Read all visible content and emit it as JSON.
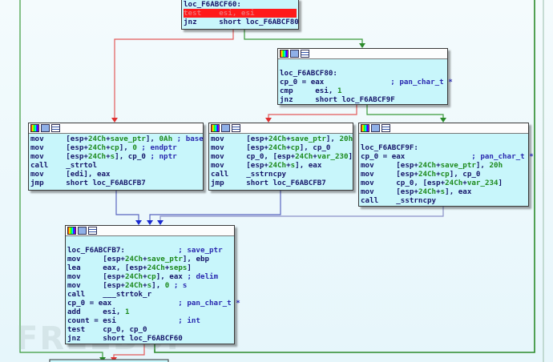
{
  "colors": {
    "true_edge": "#2a8a2a",
    "false_edge": "#e03030",
    "jump_edge": "#3040c0",
    "block_bg": "#c8f6fb",
    "highlight": "#ff1a1a"
  },
  "header_icons": [
    "graph-overview-icon",
    "edit-icon",
    "listing-icon"
  ],
  "blocks": [
    {
      "id": "loc_F6ABCF60",
      "header": false,
      "lines": [
        [
          [
            "loc_F6ABCF60:",
            "i"
          ]
        ],
        [
          [
            "test    ",
            "i"
          ],
          [
            "esi, esi",
            "i"
          ]
        ],
        [
          [
            "jnz     ",
            "i"
          ],
          [
            "short loc_F6ABCF80",
            "i"
          ]
        ]
      ],
      "highlight": 1
    },
    {
      "id": "loc_F6ABCF80",
      "header": true,
      "lines": [
        [
          [
            "",
            "i"
          ]
        ],
        [
          [
            "loc_F6ABCF80:",
            "i"
          ]
        ],
        [
          [
            "cp_0 = eax",
            "i"
          ],
          [
            "               ; pan_char_t *",
            "b"
          ]
        ],
        [
          [
            "cmp     ",
            "i"
          ],
          [
            "esi, ",
            "i"
          ],
          [
            "1",
            "g"
          ]
        ],
        [
          [
            "jnz     ",
            "i"
          ],
          [
            "short loc_F6ABCF9F",
            "i"
          ]
        ]
      ]
    },
    {
      "id": "block_strtol",
      "header": true,
      "lines": [
        [
          [
            "mov     ",
            "i"
          ],
          [
            "[esp+",
            "i"
          ],
          [
            "24Ch",
            "g"
          ],
          [
            "+",
            "i"
          ],
          [
            "save_ptr",
            "g"
          ],
          [
            "], ",
            "i"
          ],
          [
            "0Ah",
            "g"
          ],
          [
            " ; base",
            "b"
          ]
        ],
        [
          [
            "mov     ",
            "i"
          ],
          [
            "[esp+",
            "i"
          ],
          [
            "24Ch",
            "g"
          ],
          [
            "+",
            "i"
          ],
          [
            "cp",
            "g"
          ],
          [
            "], ",
            "i"
          ],
          [
            "0",
            "g"
          ],
          [
            " ; endptr",
            "b"
          ]
        ],
        [
          [
            "mov     ",
            "i"
          ],
          [
            "[esp+",
            "i"
          ],
          [
            "24Ch",
            "g"
          ],
          [
            "+",
            "i"
          ],
          [
            "s",
            "g"
          ],
          [
            "], cp_0",
            "i"
          ],
          [
            " ; nptr",
            "b"
          ]
        ],
        [
          [
            "call    ",
            "i"
          ],
          [
            "_strtol",
            "i"
          ]
        ],
        [
          [
            "mov     ",
            "i"
          ],
          [
            "[edi], eax",
            "i"
          ]
        ],
        [
          [
            "jmp     ",
            "i"
          ],
          [
            "short loc_F6ABCFB7",
            "i"
          ]
        ]
      ]
    },
    {
      "id": "block_sstrncpy_230",
      "header": true,
      "lines": [
        [
          [
            "mov     ",
            "i"
          ],
          [
            "[esp+",
            "i"
          ],
          [
            "24Ch",
            "g"
          ],
          [
            "+",
            "i"
          ],
          [
            "save_ptr",
            "g"
          ],
          [
            "], ",
            "i"
          ],
          [
            "20h",
            "g"
          ]
        ],
        [
          [
            "mov     ",
            "i"
          ],
          [
            "[esp+",
            "i"
          ],
          [
            "24Ch",
            "g"
          ],
          [
            "+",
            "i"
          ],
          [
            "cp",
            "g"
          ],
          [
            "], cp_0",
            "i"
          ]
        ],
        [
          [
            "mov     ",
            "i"
          ],
          [
            "cp_0, [esp+",
            "i"
          ],
          [
            "24Ch",
            "g"
          ],
          [
            "+",
            "i"
          ],
          [
            "var_230",
            "g"
          ],
          [
            "]",
            "i"
          ]
        ],
        [
          [
            "mov     ",
            "i"
          ],
          [
            "[esp+",
            "i"
          ],
          [
            "24Ch",
            "g"
          ],
          [
            "+",
            "i"
          ],
          [
            "s",
            "g"
          ],
          [
            "], eax",
            "i"
          ]
        ],
        [
          [
            "call    ",
            "i"
          ],
          [
            "_sstrncpy",
            "i"
          ]
        ],
        [
          [
            "jmp     ",
            "i"
          ],
          [
            "short loc_F6ABCFB7",
            "i"
          ]
        ]
      ]
    },
    {
      "id": "loc_F6ABCF9F",
      "header": true,
      "lines": [
        [
          [
            "",
            "i"
          ]
        ],
        [
          [
            "loc_F6ABCF9F:",
            "i"
          ]
        ],
        [
          [
            "cp_0 = eax",
            "i"
          ],
          [
            "               ; pan_char_t *",
            "b"
          ]
        ],
        [
          [
            "mov     ",
            "i"
          ],
          [
            "[esp+",
            "i"
          ],
          [
            "24Ch",
            "g"
          ],
          [
            "+",
            "i"
          ],
          [
            "save_ptr",
            "g"
          ],
          [
            "], ",
            "i"
          ],
          [
            "20h",
            "g"
          ]
        ],
        [
          [
            "mov     ",
            "i"
          ],
          [
            "[esp+",
            "i"
          ],
          [
            "24Ch",
            "g"
          ],
          [
            "+",
            "i"
          ],
          [
            "cp",
            "g"
          ],
          [
            "], cp_0",
            "i"
          ]
        ],
        [
          [
            "mov     ",
            "i"
          ],
          [
            "cp_0, [esp+",
            "i"
          ],
          [
            "24Ch",
            "g"
          ],
          [
            "+",
            "i"
          ],
          [
            "var_234",
            "g"
          ],
          [
            "]",
            "i"
          ]
        ],
        [
          [
            "mov     ",
            "i"
          ],
          [
            "[esp+",
            "i"
          ],
          [
            "24Ch",
            "g"
          ],
          [
            "+",
            "i"
          ],
          [
            "s",
            "g"
          ],
          [
            "], eax",
            "i"
          ]
        ],
        [
          [
            "call    ",
            "i"
          ],
          [
            "_sstrncpy",
            "i"
          ]
        ]
      ]
    },
    {
      "id": "loc_F6ABCFB7",
      "header": true,
      "lines": [
        [
          [
            "",
            "i"
          ]
        ],
        [
          [
            "loc_F6ABCFB7:",
            "i"
          ],
          [
            "            ; save_ptr",
            "b"
          ]
        ],
        [
          [
            "mov     ",
            "i"
          ],
          [
            "[esp+",
            "i"
          ],
          [
            "24Ch",
            "g"
          ],
          [
            "+",
            "i"
          ],
          [
            "save_ptr",
            "g"
          ],
          [
            "], ebp",
            "i"
          ]
        ],
        [
          [
            "lea     ",
            "i"
          ],
          [
            "eax, [esp+",
            "i"
          ],
          [
            "24Ch",
            "g"
          ],
          [
            "+",
            "i"
          ],
          [
            "seps",
            "g"
          ],
          [
            "]",
            "i"
          ]
        ],
        [
          [
            "mov     ",
            "i"
          ],
          [
            "[esp+",
            "i"
          ],
          [
            "24Ch",
            "g"
          ],
          [
            "+",
            "i"
          ],
          [
            "cp",
            "g"
          ],
          [
            "], eax",
            "i"
          ],
          [
            " ; delim",
            "b"
          ]
        ],
        [
          [
            "mov     ",
            "i"
          ],
          [
            "[esp+",
            "i"
          ],
          [
            "24Ch",
            "g"
          ],
          [
            "+",
            "i"
          ],
          [
            "s",
            "g"
          ],
          [
            "], ",
            "i"
          ],
          [
            "0",
            "g"
          ],
          [
            " ; s",
            "b"
          ]
        ],
        [
          [
            "call    ",
            "i"
          ],
          [
            "___strtok_r",
            "i"
          ]
        ],
        [
          [
            "cp_0 = eax",
            "i"
          ],
          [
            "               ; pan_char_t *",
            "b"
          ]
        ],
        [
          [
            "add     ",
            "i"
          ],
          [
            "esi, ",
            "i"
          ],
          [
            "1",
            "g"
          ]
        ],
        [
          [
            "count = esi",
            "i"
          ],
          [
            "              ; int",
            "b"
          ]
        ],
        [
          [
            "test    ",
            "i"
          ],
          [
            "cp_0, cp_0",
            "i"
          ]
        ],
        [
          [
            "jnz     ",
            "i"
          ],
          [
            "short loc_F6ABCF60",
            "i"
          ]
        ]
      ]
    }
  ]
}
